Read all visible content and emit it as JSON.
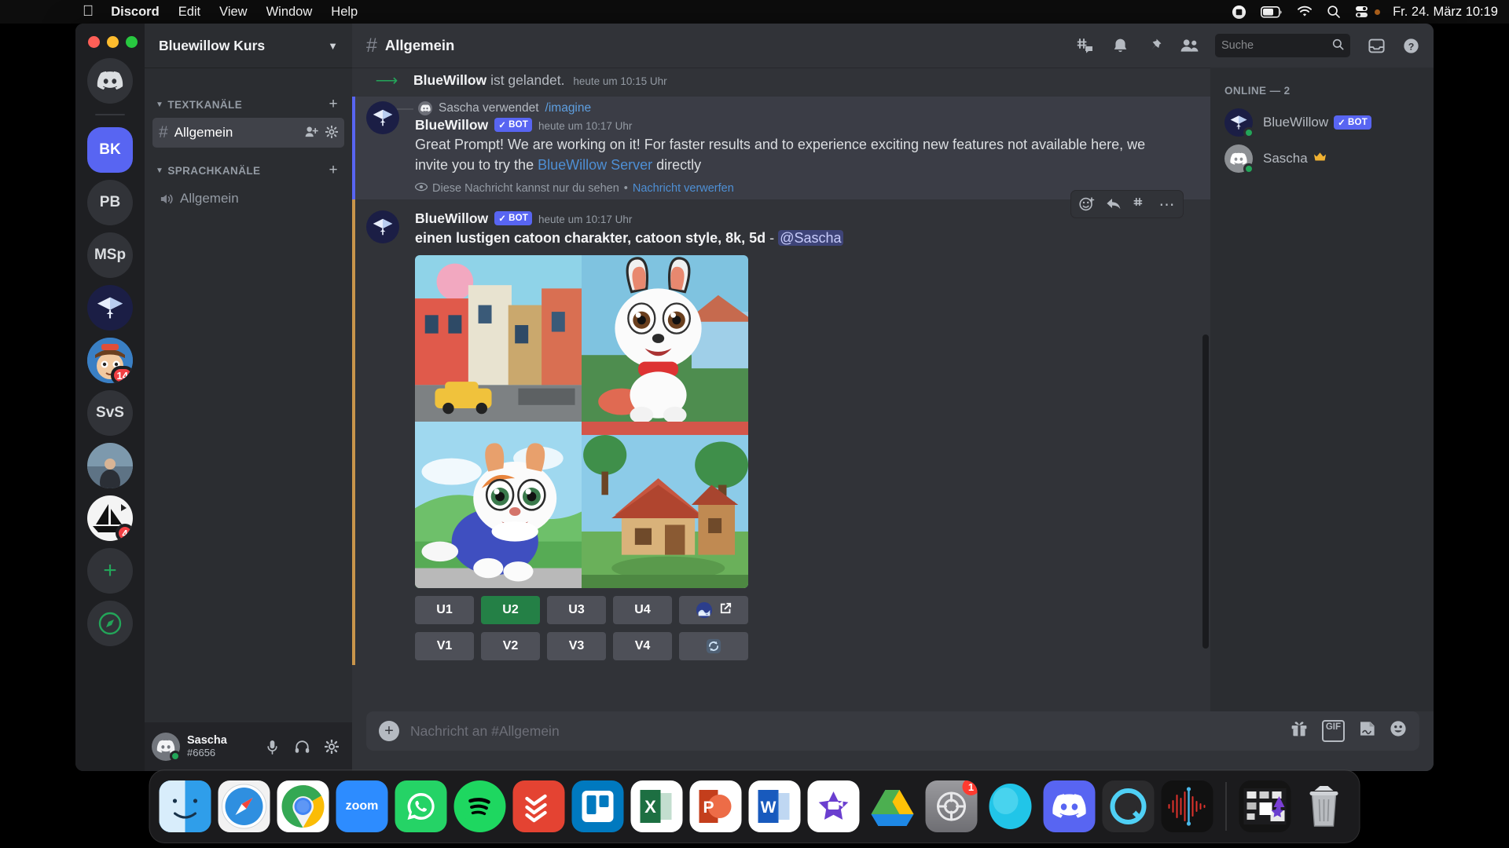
{
  "menubar": {
    "apple_icon": "apple-icon",
    "items": [
      "Discord",
      "Edit",
      "View",
      "Window",
      "Help"
    ],
    "status_icons": [
      "screen-record-icon",
      "battery-icon",
      "wifi-icon",
      "search-icon",
      "control-center-icon"
    ],
    "clock": "Fr. 24. März  10:19"
  },
  "guild_rail": {
    "home_label": "discord-home",
    "guilds": [
      {
        "label": "BK",
        "name": "guild-bk",
        "selected": true,
        "badge": null
      },
      {
        "label": "PB",
        "name": "guild-pb",
        "selected": false,
        "badge": null
      },
      {
        "label": "MSp",
        "name": "guild-msp",
        "selected": false,
        "badge": null
      },
      {
        "label": "",
        "name": "guild-bluewillow",
        "selected": false,
        "badge": null
      },
      {
        "label": "",
        "name": "guild-avatar-boy",
        "selected": false,
        "badge": "14"
      },
      {
        "label": "SvS",
        "name": "guild-svs",
        "selected": false,
        "badge": null
      },
      {
        "label": "",
        "name": "guild-photo",
        "selected": false,
        "badge": null
      },
      {
        "label": "",
        "name": "guild-sailboat",
        "selected": false,
        "badge": "4"
      }
    ],
    "add_server_label": "+",
    "explore_label": "compass"
  },
  "sidebar": {
    "server_name": "Bluewillow Kurs",
    "categories": [
      {
        "label": "TEXTKANÄLE",
        "name": "category-text-channels",
        "channels": [
          {
            "label": "Allgemein",
            "type": "text",
            "active": true
          }
        ]
      },
      {
        "label": "SPRACHKANÄLE",
        "name": "category-voice-channels",
        "channels": [
          {
            "label": "Allgemein",
            "type": "voice",
            "active": false
          }
        ]
      }
    ],
    "user": {
      "name": "Sascha",
      "tag": "#6656",
      "icons": [
        "microphone-icon",
        "headphones-icon",
        "settings-gear-icon"
      ]
    }
  },
  "topbar": {
    "channel_name": "Allgemein",
    "icons": [
      "threads-icon",
      "notification-bell-icon",
      "pin-icon",
      "members-icon"
    ],
    "search_placeholder": "Suche",
    "right_icons": [
      "inbox-icon",
      "help-icon"
    ]
  },
  "messages": {
    "system": {
      "author": "BlueWillow",
      "text": "ist gelandet.",
      "timestamp": "heute um 10:15 Uhr"
    },
    "first": {
      "reply_user": "Sascha verwendet",
      "reply_command": "/imagine",
      "author": "BlueWillow",
      "bot_tag": "BOT",
      "timestamp": "heute um 10:17 Uhr",
      "body_part1": "Great Prompt! We are working on it! For faster results and to experience exciting new features not available here, we invite you to try the ",
      "body_link": "BlueWillow Server",
      "body_part2": " directly",
      "ephemeral_text": "Diese Nachricht kannst nur du sehen",
      "ephemeral_sep": "•",
      "ephemeral_action": "Nachricht verwerfen"
    },
    "second": {
      "author": "BlueWillow",
      "bot_tag": "BOT",
      "timestamp": "heute um 10:17 Uhr",
      "prompt": "einen lustigen catoon charakter, catoon style, 8k, 5d",
      "prompt_dash": "-",
      "mention": "@Sascha",
      "hover_icons": [
        "add-reaction-icon",
        "reply-icon",
        "thread-icon",
        "more-options-icon"
      ],
      "upscale_buttons": [
        "U1",
        "U2",
        "U3",
        "U4"
      ],
      "variation_buttons": [
        "V1",
        "V2",
        "V3",
        "V4"
      ],
      "selected_button": "U2",
      "web_button_label": "open-in-browser",
      "reroll_button_label": "reroll"
    }
  },
  "composer": {
    "placeholder": "Nachricht an #Allgemein",
    "tools": [
      "gift-icon",
      "GIF",
      "sticker-icon",
      "emoji-icon"
    ]
  },
  "members": {
    "header": "ONLINE — 2",
    "list": [
      {
        "name": "BlueWillow",
        "bot_tag": "BOT",
        "crown": false
      },
      {
        "name": "Sascha",
        "bot_tag": null,
        "crown": true
      }
    ]
  },
  "dock": {
    "apps": [
      {
        "name": "finder",
        "running": true
      },
      {
        "name": "safari",
        "running": true
      },
      {
        "name": "chrome",
        "running": true
      },
      {
        "name": "zoom",
        "running": false
      },
      {
        "name": "whatsapp",
        "running": true
      },
      {
        "name": "spotify",
        "running": false
      },
      {
        "name": "todoist",
        "running": true
      },
      {
        "name": "trello",
        "running": true
      },
      {
        "name": "excel",
        "running": false
      },
      {
        "name": "powerpoint",
        "running": false
      },
      {
        "name": "word",
        "running": false
      },
      {
        "name": "imovie",
        "running": true
      },
      {
        "name": "google-drive",
        "running": false
      },
      {
        "name": "system-settings",
        "running": false,
        "badge": "1"
      },
      {
        "name": "ellipse-app",
        "running": false
      },
      {
        "name": "discord",
        "running": true
      },
      {
        "name": "quicktime",
        "running": true
      },
      {
        "name": "audio-waveform",
        "running": false
      }
    ],
    "downloads_label": "downloads-stack",
    "trash_label": "trash"
  },
  "colors": {
    "brand": "#5865f2",
    "green": "#248046",
    "online": "#23a559",
    "link": "#4e8fd4",
    "badge_red": "#f23f43"
  }
}
